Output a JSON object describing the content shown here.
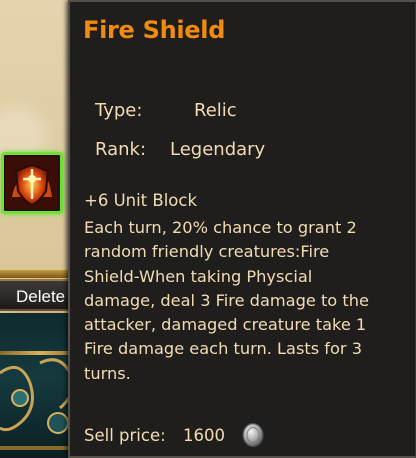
{
  "background": {
    "delete_label": "Delete"
  },
  "tooltip": {
    "title": "Fire Shield",
    "type_label": "Type:",
    "type_value": "Relic",
    "rank_label": "Rank:",
    "rank_value": "Legendary",
    "stat": "+6 Unit Block",
    "description_lines": [
      "Each turn, 20% chance to grant 2",
      "random friendly creatures:Fire",
      "Shield-When taking Physcial",
      "damage, deal 3 Fire damage to the",
      "attacker, damaged creature take 1",
      "Fire damage each turn. Lasts for 3",
      "turns."
    ],
    "sell_price_label": "Sell price:",
    "sell_price_value": "1600",
    "currency_icon": "silver-coin-icon"
  },
  "colors": {
    "title": "#f08b0f",
    "text": "#f2dcb4",
    "tooltip_bg": "#201e1c",
    "slot_highlight": "#6ee13a"
  }
}
